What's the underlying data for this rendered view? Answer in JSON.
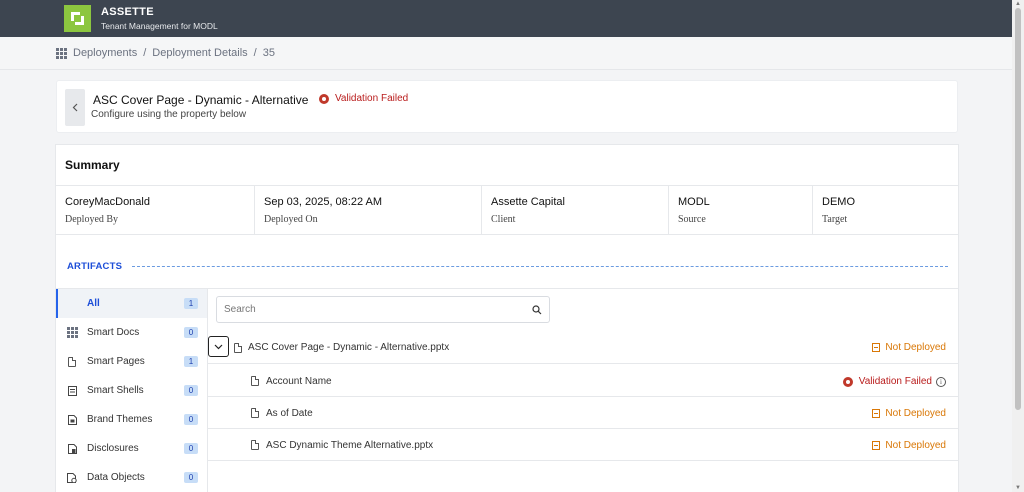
{
  "app": {
    "brand_title": "ASSETTE",
    "brand_subtitle": "Tenant Management for MODL"
  },
  "breadcrumb": {
    "items": [
      "Deployments",
      "Deployment Details",
      "35"
    ],
    "separator": "/"
  },
  "header": {
    "title": "ASC Cover Page - Dynamic - Alternative",
    "subtitle": "Configure using the property below",
    "status": "Validation Failed",
    "back_icon": "chevron-left-icon"
  },
  "summary": {
    "title": "Summary",
    "cells": [
      {
        "value": "CoreyMacDonald",
        "label": "Deployed By"
      },
      {
        "value": "Sep 03, 2025, 08:22 AM",
        "label": "Deployed On"
      },
      {
        "value": "Assette Capital",
        "label": "Client"
      },
      {
        "value": "MODL",
        "label": "Source"
      },
      {
        "value": "DEMO",
        "label": "Target"
      }
    ]
  },
  "artifacts": {
    "title": "ARTIFACTS",
    "sidebar": [
      {
        "label": "All",
        "count": "1",
        "icon": "none"
      },
      {
        "label": "Smart Docs",
        "count": "0",
        "icon": "grid-icon"
      },
      {
        "label": "Smart Pages",
        "count": "1",
        "icon": "page-icon"
      },
      {
        "label": "Smart Shells",
        "count": "0",
        "icon": "shell-icon"
      },
      {
        "label": "Brand Themes",
        "count": "0",
        "icon": "theme-icon"
      },
      {
        "label": "Disclosures",
        "count": "0",
        "icon": "disclosure-icon"
      },
      {
        "label": "Data Objects",
        "count": "0",
        "icon": "data-object-icon"
      }
    ],
    "search_placeholder": "Search",
    "parent": {
      "name": "ASC Cover Page - Dynamic - Alternative.pptx",
      "status": "Not Deployed"
    },
    "children": [
      {
        "name": "Account Name",
        "status": "Validation Failed"
      },
      {
        "name": "As of Date",
        "status": "Not Deployed"
      },
      {
        "name": "ASC Dynamic Theme Alternative.pptx",
        "status": "Not Deployed"
      }
    ]
  },
  "colors": {
    "topbar": "#3d4550",
    "logo": "#8cc63f",
    "accent": "#1d4ed8",
    "error": "#b91c1c",
    "warning": "#d97706"
  }
}
